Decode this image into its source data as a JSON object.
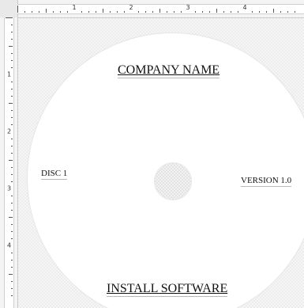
{
  "ruler": {
    "horizontal_numbers": [
      "1",
      "2",
      "3",
      "4"
    ],
    "vertical_numbers": [
      "1",
      "2",
      "3",
      "4"
    ]
  },
  "disc_label": {
    "top_text": "COMPANY NAME",
    "left_text": "DISC 1",
    "right_text": "VERSION 1.0",
    "bottom_text": "INSTALL SOFTWARE"
  },
  "colors": {
    "canvas_background": "#f6f6f6",
    "disc_fill": "#ffffff",
    "text": "#111111"
  }
}
